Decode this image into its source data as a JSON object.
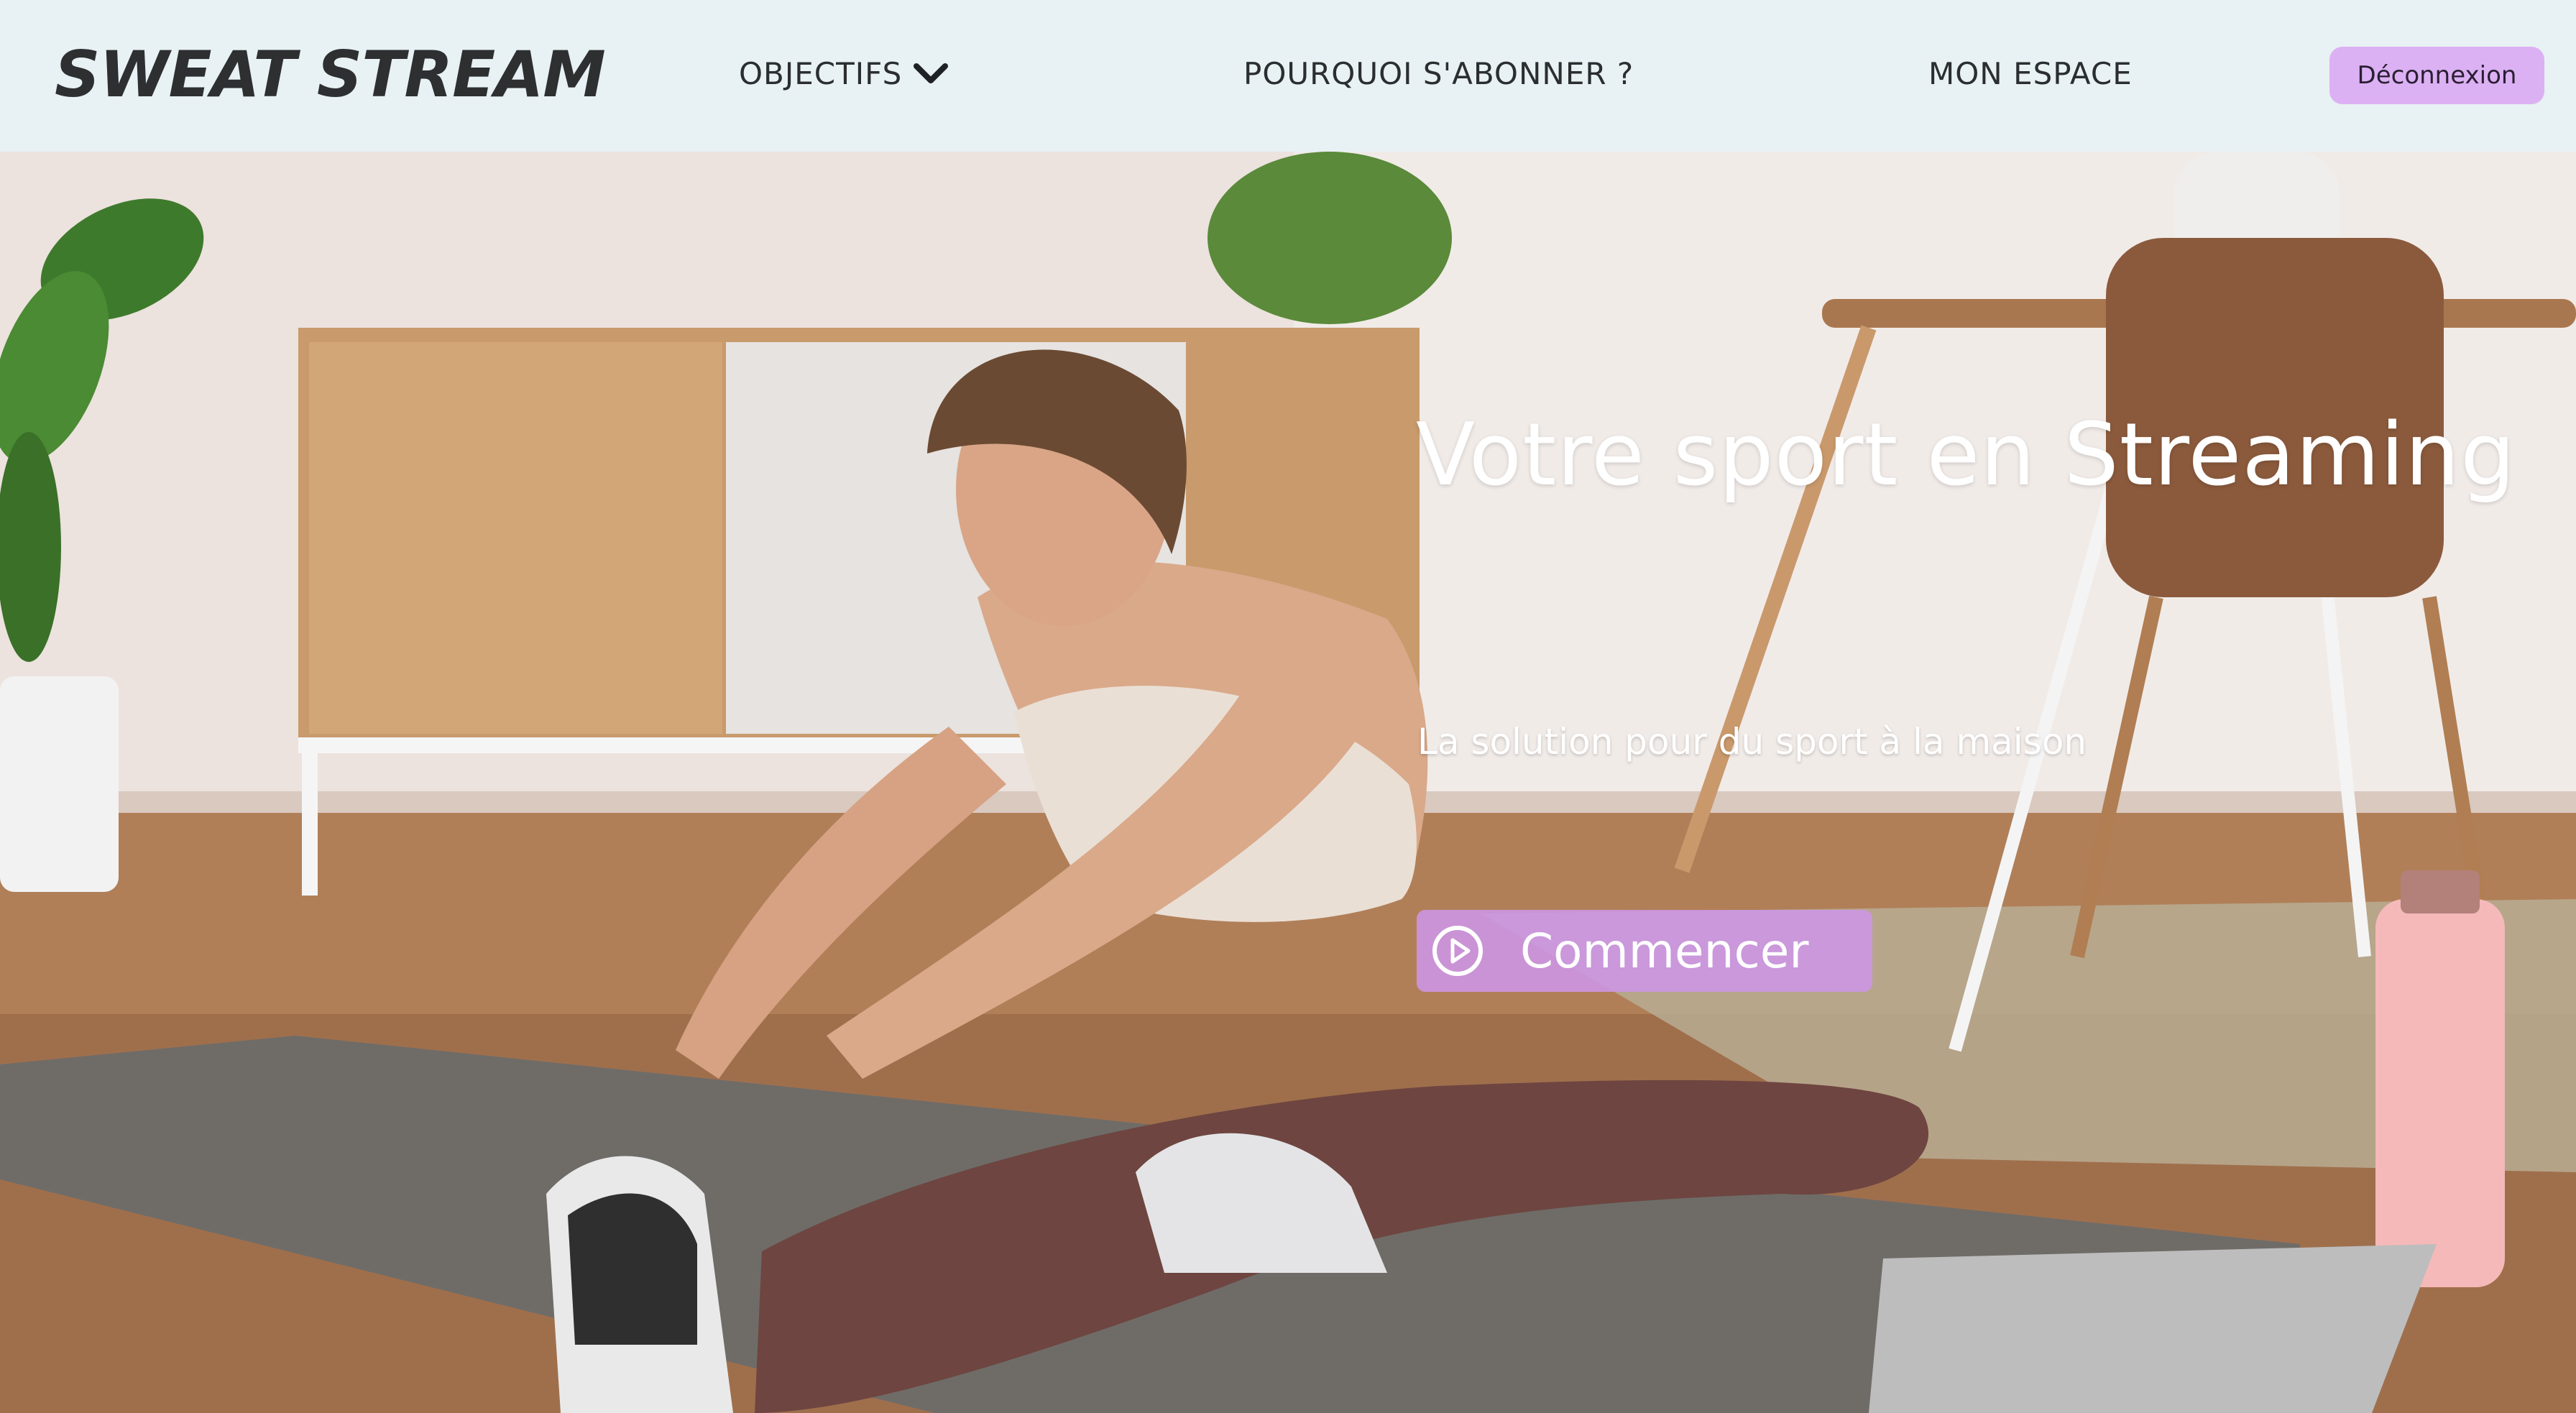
{
  "header": {
    "logo": "SWEAT STREAM",
    "nav": {
      "objectifs": "OBJECTIFS",
      "pourquoi": "POURQUOI S'ABONNER ?",
      "espace": "MON ESPACE"
    },
    "logout_label": "Déconnexion"
  },
  "hero": {
    "title": "Votre sport en Streaming",
    "subtitle": "La solution pour du sport à la maison",
    "cta_label": "Commencer",
    "image": "woman-stretching-on-yoga-mat-photo"
  },
  "colors": {
    "header_bg": "#e8f1f3",
    "accent": "#dcb1f3",
    "cta_bg": "#cd96e6",
    "text_dark": "#2d2f31"
  },
  "icons": {
    "dropdown": "chevron-down-icon",
    "play": "play-circle-icon"
  }
}
